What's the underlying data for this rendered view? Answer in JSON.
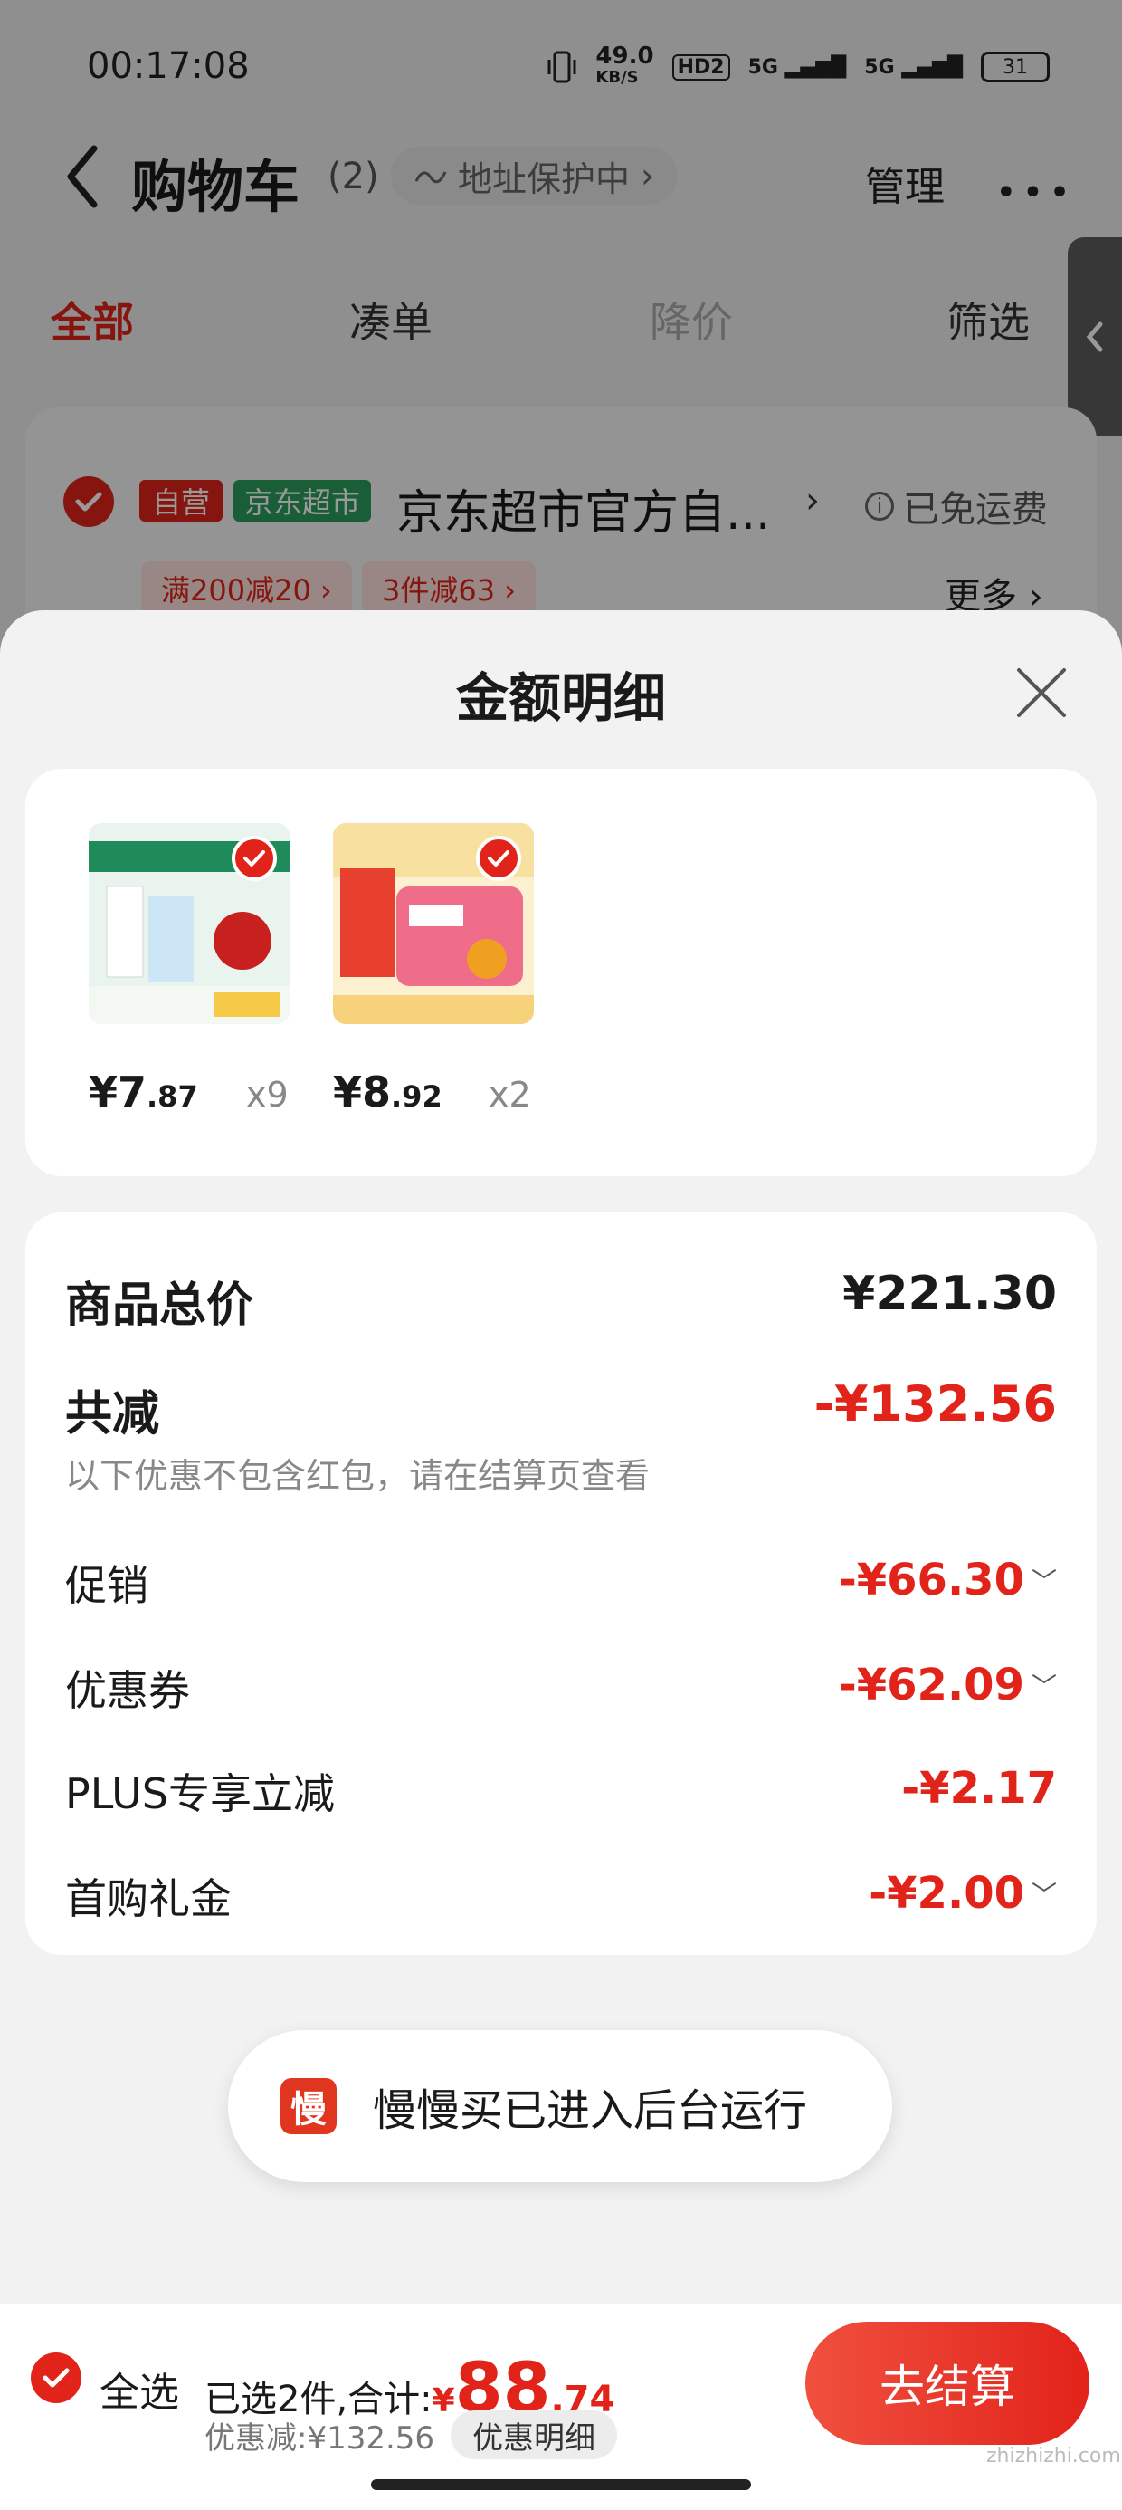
{
  "status_bar": {
    "time": "00:17:08",
    "speed": "49.0",
    "speed_unit": "KB/S",
    "hd": "HD2",
    "net1": "5G",
    "net2": "5G",
    "battery": "31"
  },
  "header": {
    "title": "购物车",
    "count": "(2)",
    "address": "地址保护中",
    "address_chevron": "›",
    "manage": "管理",
    "more": "•••"
  },
  "tabs": [
    {
      "label": "全部"
    },
    {
      "label": "凑单"
    },
    {
      "label": "降价"
    },
    {
      "label": "筛选"
    }
  ],
  "store": {
    "self_tag": "自营",
    "channel_tag": "京东超市",
    "name": "京东超市官方自...",
    "chevron": "›",
    "shipping": "已免运费",
    "info": "i",
    "promos": [
      "满200减20 ›",
      "3件减63 ›"
    ],
    "more": "更多 ›"
  },
  "modal": {
    "title": "金额明细",
    "items": [
      {
        "price_int": "¥7",
        "price_dec": ".87",
        "qty": "x9",
        "image": "milk-product-image",
        "thumb_colors": {
          "top": "#e9f4ee",
          "band": "#1f8a5a",
          "accent": "#c8201f"
        }
      },
      {
        "price_int": "¥8",
        "price_dec": ".92",
        "qty": "x2",
        "image": "liby-detergent-image",
        "thumb_colors": {
          "top": "#f8e0a0",
          "band": "#f0a020",
          "accent": "#f06d8a"
        }
      }
    ],
    "summary": {
      "goods_total_label": "商品总价",
      "goods_total_value": "¥221.30",
      "reduce_label": "共减",
      "reduce_value": "-¥132.56",
      "reduce_hint": "以下优惠不包含红包，请在结算页查看",
      "rows": [
        {
          "label": "促销",
          "value": "-¥66.30",
          "expandable": true
        },
        {
          "label": "优惠券",
          "value": "-¥62.09",
          "expandable": true
        },
        {
          "label": "PLUS专享立减",
          "value": "-¥2.17",
          "expandable": false
        },
        {
          "label": "首购礼金",
          "value": "-¥2.00",
          "expandable": true
        }
      ]
    }
  },
  "toast": {
    "icon_char": "慢",
    "text": "慢慢买已进入后台运行"
  },
  "bottom_bar": {
    "select_all": "全选",
    "summary_prefix": "已选2件,合计:",
    "total_yen": "¥",
    "total_int": "88",
    "total_dec": ".74",
    "discount": "优惠减:¥132.56",
    "detail_button": "优惠明细",
    "checkout": "去结算"
  },
  "watermark": "zhizhizhi.com",
  "colors": {
    "accent": "#e2231a",
    "green_tag": "#2a9d5c"
  }
}
